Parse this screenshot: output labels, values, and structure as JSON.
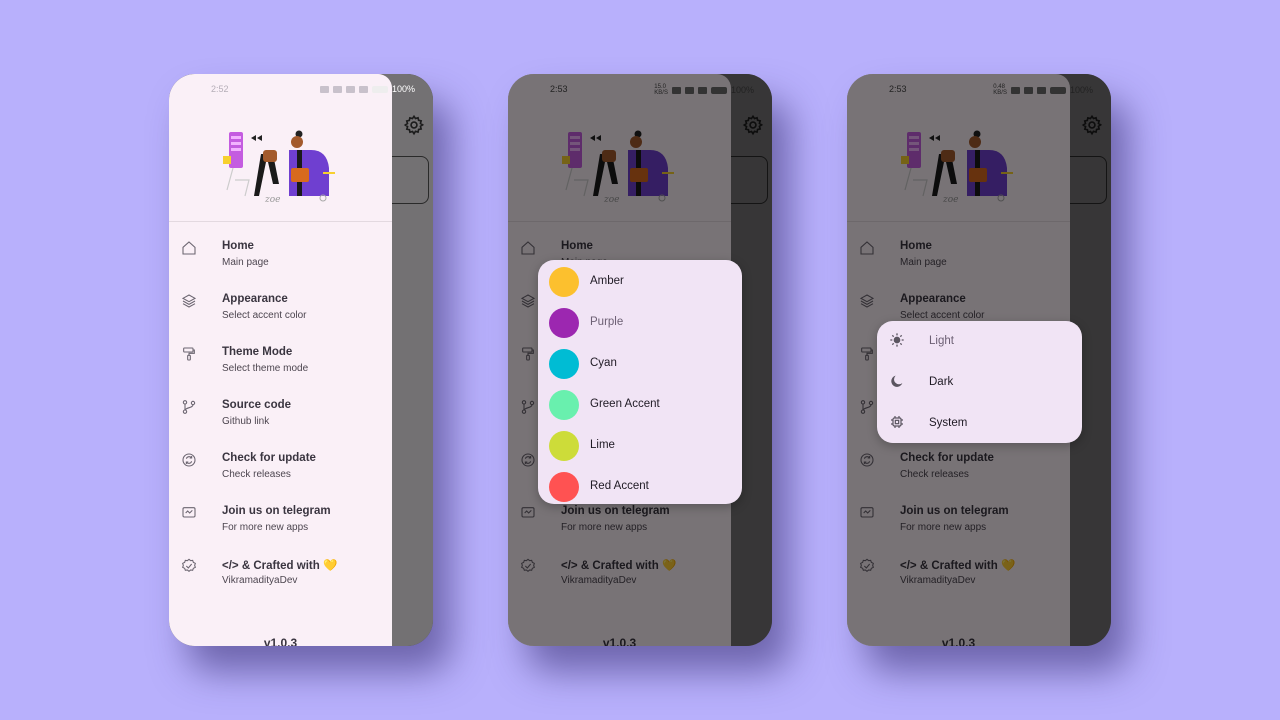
{
  "screens": [
    {
      "status": {
        "time": "2:52",
        "network": "",
        "battery": "100%"
      },
      "drawer_state": "open"
    },
    {
      "status": {
        "time": "2:53",
        "network": "15.0\nKB/S",
        "battery": "100%"
      },
      "drawer_state": "accent-dialog"
    },
    {
      "status": {
        "time": "2:53",
        "network": "0.48\nKB/S",
        "battery": "100%"
      },
      "drawer_state": "theme-dialog"
    }
  ],
  "menu": [
    {
      "title": "Home",
      "subtitle": "Main page",
      "icon": "home-icon"
    },
    {
      "title": "Appearance",
      "subtitle": "Select accent color",
      "icon": "layers-icon"
    },
    {
      "title": "Theme Mode",
      "subtitle": "Select theme mode",
      "icon": "paint-roller-icon"
    },
    {
      "title": "Source code",
      "subtitle": "Github link",
      "icon": "git-branch-icon"
    },
    {
      "title": "Check for update",
      "subtitle": "Check releases",
      "icon": "refresh-icon"
    },
    {
      "title": "Join us on telegram",
      "subtitle": "For more new apps",
      "icon": "chat-icon"
    },
    {
      "title": "</> & Crafted with 💛",
      "subtitle": "VikramadityaDev",
      "icon": "verified-badge-icon"
    }
  ],
  "version": "v1.0.3",
  "accent_options": [
    {
      "label": "Amber",
      "color": "#fcc02e"
    },
    {
      "label": "Purple",
      "color": "#9c27b0"
    },
    {
      "label": "Cyan",
      "color": "#00bcd4"
    },
    {
      "label": "Green Accent",
      "color": "#69f0ae"
    },
    {
      "label": "Lime",
      "color": "#cddc39"
    },
    {
      "label": "Red Accent",
      "color": "#ff5252"
    }
  ],
  "theme_options": [
    {
      "label": "Light",
      "icon": "sun-icon"
    },
    {
      "label": "Dark",
      "icon": "moon-icon"
    },
    {
      "label": "System",
      "icon": "chip-icon"
    }
  ],
  "colors": {
    "background": "#b8b0fc",
    "drawer": "#faf0f7",
    "dialog": "#f1e4f5"
  }
}
